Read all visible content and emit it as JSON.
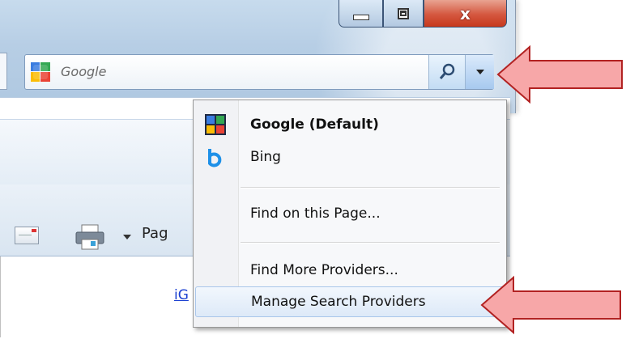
{
  "search": {
    "placeholder": "Google",
    "provider_icon": "google-icon",
    "search_icon": "magnifier-icon",
    "dropdown_icon": "chevron-down-icon"
  },
  "window_controls": {
    "minimize_icon": "minimize-icon",
    "maximize_icon": "restore-icon",
    "close_glyph": "x"
  },
  "toolbar": {
    "mail_icon": "mail-icon",
    "print_icon": "printer-icon",
    "page_label": "Pag"
  },
  "content": {
    "link_text": "iG"
  },
  "menu": {
    "items": [
      {
        "label": "Google (Default)",
        "icon": "google-icon",
        "bold": true
      },
      {
        "label": "Bing",
        "icon": "bing-icon"
      },
      {
        "label": "Find on this Page..."
      },
      {
        "label": "Find More Providers..."
      },
      {
        "label": "Manage Search Providers",
        "highlighted": true
      }
    ]
  },
  "colors": {
    "arrow_fill": "#f7a7a8",
    "arrow_stroke": "#b22222",
    "close_button": "#c7391d",
    "link": "#1a3fd1"
  }
}
